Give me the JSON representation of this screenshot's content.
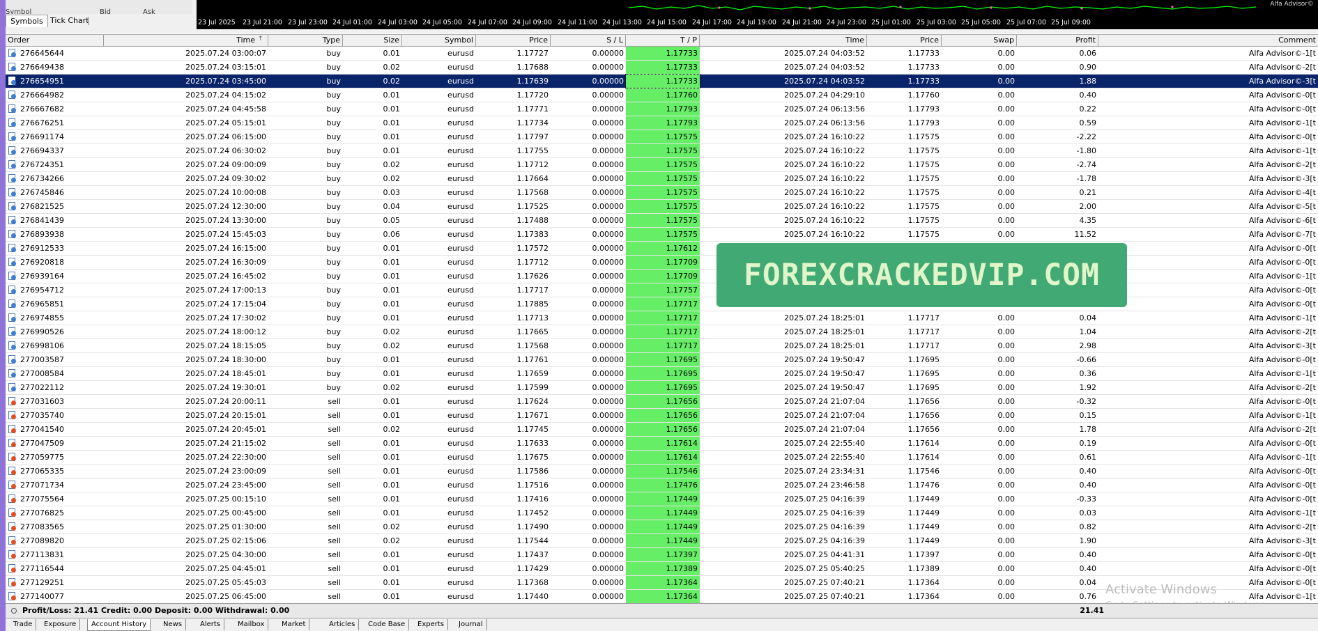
{
  "market_watch": {
    "col_symbol": "Symbol",
    "col_bid": "Bid",
    "col_ask": "Ask",
    "tabs": [
      "Symbols",
      "Tick Chart"
    ]
  },
  "chart": {
    "time_labels": [
      "23 Jul 2025",
      "23 Jul 21:00",
      "23 Jul 23:00",
      "24 Jul 01:00",
      "24 Jul 03:00",
      "24 Jul 05:00",
      "24 Jul 07:00",
      "24 Jul 09:00",
      "24 Jul 11:00",
      "24 Jul 13:00",
      "24 Jul 15:00",
      "24 Jul 17:00",
      "24 Jul 19:00",
      "24 Jul 21:00",
      "24 Jul 23:00",
      "25 Jul 01:00",
      "25 Jul 03:00",
      "25 Jul 05:00",
      "25 Jul 07:00",
      "25 Jul 09:00"
    ],
    "corner_label": "Alfa Advisor©",
    "accent": "#00ff00"
  },
  "table": {
    "headers": [
      "Order",
      "Time",
      "Type",
      "Size",
      "Symbol",
      "Price",
      "S / L",
      "T / P",
      "Time",
      "Price",
      "Swap",
      "Profit",
      "Comment"
    ],
    "selected_index": 2,
    "rows": [
      [
        "276645644",
        "2025.07.24 03:00:07",
        "buy",
        "0.01",
        "eurusd",
        "1.17727",
        "0.00000",
        "1.17733",
        "2025.07.24 04:03:52",
        "1.17733",
        "0.00",
        "0.06",
        "Alfa Advisor©-1[t"
      ],
      [
        "276649438",
        "2025.07.24 03:15:01",
        "buy",
        "0.02",
        "eurusd",
        "1.17688",
        "0.00000",
        "1.17733",
        "2025.07.24 04:03:52",
        "1.17733",
        "0.00",
        "0.90",
        "Alfa Advisor©-2[t"
      ],
      [
        "276654951",
        "2025.07.24 03:45:00",
        "buy",
        "0.02",
        "eurusd",
        "1.17639",
        "0.00000",
        "1.17733",
        "2025.07.24 04:03:52",
        "1.17733",
        "0.00",
        "1.88",
        "Alfa Advisor©-3[t"
      ],
      [
        "276664982",
        "2025.07.24 04:15:02",
        "buy",
        "0.01",
        "eurusd",
        "1.17720",
        "0.00000",
        "1.17760",
        "2025.07.24 04:29:10",
        "1.17760",
        "0.00",
        "0.40",
        "Alfa Advisor©-0[t"
      ],
      [
        "276667682",
        "2025.07.24 04:45:58",
        "buy",
        "0.01",
        "eurusd",
        "1.17771",
        "0.00000",
        "1.17793",
        "2025.07.24 06:13:56",
        "1.17793",
        "0.00",
        "0.22",
        "Alfa Advisor©-0[t"
      ],
      [
        "276676251",
        "2025.07.24 05:15:01",
        "buy",
        "0.01",
        "eurusd",
        "1.17734",
        "0.00000",
        "1.17793",
        "2025.07.24 06:13:56",
        "1.17793",
        "0.00",
        "0.59",
        "Alfa Advisor©-1[t"
      ],
      [
        "276691174",
        "2025.07.24 06:15:00",
        "buy",
        "0.01",
        "eurusd",
        "1.17797",
        "0.00000",
        "1.17575",
        "2025.07.24 16:10:22",
        "1.17575",
        "0.00",
        "-2.22",
        "Alfa Advisor©-0[t"
      ],
      [
        "276694337",
        "2025.07.24 06:30:02",
        "buy",
        "0.01",
        "eurusd",
        "1.17755",
        "0.00000",
        "1.17575",
        "2025.07.24 16:10:22",
        "1.17575",
        "0.00",
        "-1.80",
        "Alfa Advisor©-1[t"
      ],
      [
        "276724351",
        "2025.07.24 09:00:09",
        "buy",
        "0.02",
        "eurusd",
        "1.17712",
        "0.00000",
        "1.17575",
        "2025.07.24 16:10:22",
        "1.17575",
        "0.00",
        "-2.74",
        "Alfa Advisor©-2[t"
      ],
      [
        "276734266",
        "2025.07.24 09:30:02",
        "buy",
        "0.02",
        "eurusd",
        "1.17664",
        "0.00000",
        "1.17575",
        "2025.07.24 16:10:22",
        "1.17575",
        "0.00",
        "-1.78",
        "Alfa Advisor©-3[t"
      ],
      [
        "276745846",
        "2025.07.24 10:00:08",
        "buy",
        "0.03",
        "eurusd",
        "1.17568",
        "0.00000",
        "1.17575",
        "2025.07.24 16:10:22",
        "1.17575",
        "0.00",
        "0.21",
        "Alfa Advisor©-4[t"
      ],
      [
        "276821525",
        "2025.07.24 12:30:00",
        "buy",
        "0.04",
        "eurusd",
        "1.17525",
        "0.00000",
        "1.17575",
        "2025.07.24 16:10:22",
        "1.17575",
        "0.00",
        "2.00",
        "Alfa Advisor©-5[t"
      ],
      [
        "276841439",
        "2025.07.24 13:30:00",
        "buy",
        "0.05",
        "eurusd",
        "1.17488",
        "0.00000",
        "1.17575",
        "2025.07.24 16:10:22",
        "1.17575",
        "0.00",
        "4.35",
        "Alfa Advisor©-6[t"
      ],
      [
        "276893938",
        "2025.07.24 15:45:03",
        "buy",
        "0.06",
        "eurusd",
        "1.17383",
        "0.00000",
        "1.17575",
        "2025.07.24 16:10:22",
        "1.17575",
        "0.00",
        "11.52",
        "Alfa Advisor©-7[t"
      ],
      [
        "276912533",
        "2025.07.24 16:15:00",
        "buy",
        "0.01",
        "eurusd",
        "1.17572",
        "0.00000",
        "1.17612",
        "",
        "",
        "",
        "",
        "Alfa Advisor©-0[t"
      ],
      [
        "276920818",
        "2025.07.24 16:30:09",
        "buy",
        "0.01",
        "eurusd",
        "1.17712",
        "0.00000",
        "1.17709",
        "",
        "",
        "",
        "",
        "Alfa Advisor©-0[t"
      ],
      [
        "276939164",
        "2025.07.24 16:45:02",
        "buy",
        "0.01",
        "eurusd",
        "1.17626",
        "0.00000",
        "1.17709",
        "",
        "",
        "",
        "",
        "Alfa Advisor©-1[t"
      ],
      [
        "276954712",
        "2025.07.24 17:00:13",
        "buy",
        "0.01",
        "eurusd",
        "1.17717",
        "0.00000",
        "1.17757",
        "",
        "",
        "",
        "",
        "Alfa Advisor©-0[t"
      ],
      [
        "276965851",
        "2025.07.24 17:15:04",
        "buy",
        "0.01",
        "eurusd",
        "1.17885",
        "0.00000",
        "1.17717",
        "",
        "",
        "",
        "",
        "Alfa Advisor©-0[t"
      ],
      [
        "276974855",
        "2025.07.24 17:30:02",
        "buy",
        "0.01",
        "eurusd",
        "1.17713",
        "0.00000",
        "1.17717",
        "2025.07.24 18:25:01",
        "1.17717",
        "0.00",
        "0.04",
        "Alfa Advisor©-1[t"
      ],
      [
        "276990526",
        "2025.07.24 18:00:12",
        "buy",
        "0.02",
        "eurusd",
        "1.17665",
        "0.00000",
        "1.17717",
        "2025.07.24 18:25:01",
        "1.17717",
        "0.00",
        "1.04",
        "Alfa Advisor©-2[t"
      ],
      [
        "276998106",
        "2025.07.24 18:15:05",
        "buy",
        "0.02",
        "eurusd",
        "1.17568",
        "0.00000",
        "1.17717",
        "2025.07.24 18:25:01",
        "1.17717",
        "0.00",
        "2.98",
        "Alfa Advisor©-3[t"
      ],
      [
        "277003587",
        "2025.07.24 18:30:00",
        "buy",
        "0.01",
        "eurusd",
        "1.17761",
        "0.00000",
        "1.17695",
        "2025.07.24 19:50:47",
        "1.17695",
        "0.00",
        "-0.66",
        "Alfa Advisor©-0[t"
      ],
      [
        "277008584",
        "2025.07.24 18:45:01",
        "buy",
        "0.01",
        "eurusd",
        "1.17659",
        "0.00000",
        "1.17695",
        "2025.07.24 19:50:47",
        "1.17695",
        "0.00",
        "0.36",
        "Alfa Advisor©-1[t"
      ],
      [
        "277022112",
        "2025.07.24 19:30:01",
        "buy",
        "0.02",
        "eurusd",
        "1.17599",
        "0.00000",
        "1.17695",
        "2025.07.24 19:50:47",
        "1.17695",
        "0.00",
        "1.92",
        "Alfa Advisor©-2[t"
      ],
      [
        "277031603",
        "2025.07.24 20:00:11",
        "sell",
        "0.01",
        "eurusd",
        "1.17624",
        "0.00000",
        "1.17656",
        "2025.07.24 21:07:04",
        "1.17656",
        "0.00",
        "-0.32",
        "Alfa Advisor©-0[t"
      ],
      [
        "277035740",
        "2025.07.24 20:15:01",
        "sell",
        "0.01",
        "eurusd",
        "1.17671",
        "0.00000",
        "1.17656",
        "2025.07.24 21:07:04",
        "1.17656",
        "0.00",
        "0.15",
        "Alfa Advisor©-1[t"
      ],
      [
        "277041540",
        "2025.07.24 20:45:01",
        "sell",
        "0.02",
        "eurusd",
        "1.17745",
        "0.00000",
        "1.17656",
        "2025.07.24 21:07:04",
        "1.17656",
        "0.00",
        "1.78",
        "Alfa Advisor©-2[t"
      ],
      [
        "277047509",
        "2025.07.24 21:15:02",
        "sell",
        "0.01",
        "eurusd",
        "1.17633",
        "0.00000",
        "1.17614",
        "2025.07.24 22:55:40",
        "1.17614",
        "0.00",
        "0.19",
        "Alfa Advisor©-0[t"
      ],
      [
        "277059775",
        "2025.07.24 22:30:00",
        "sell",
        "0.01",
        "eurusd",
        "1.17675",
        "0.00000",
        "1.17614",
        "2025.07.24 22:55:40",
        "1.17614",
        "0.00",
        "0.61",
        "Alfa Advisor©-1[t"
      ],
      [
        "277065335",
        "2025.07.24 23:00:09",
        "sell",
        "0.01",
        "eurusd",
        "1.17586",
        "0.00000",
        "1.17546",
        "2025.07.24 23:34:31",
        "1.17546",
        "0.00",
        "0.40",
        "Alfa Advisor©-0[t"
      ],
      [
        "277071734",
        "2025.07.24 23:45:00",
        "sell",
        "0.01",
        "eurusd",
        "1.17516",
        "0.00000",
        "1.17476",
        "2025.07.24 23:46:58",
        "1.17476",
        "0.00",
        "0.40",
        "Alfa Advisor©-0[t"
      ],
      [
        "277075564",
        "2025.07.25 00:15:10",
        "sell",
        "0.01",
        "eurusd",
        "1.17416",
        "0.00000",
        "1.17449",
        "2025.07.25 04:16:39",
        "1.17449",
        "0.00",
        "-0.33",
        "Alfa Advisor©-0[t"
      ],
      [
        "277076825",
        "2025.07.25 00:45:00",
        "sell",
        "0.01",
        "eurusd",
        "1.17452",
        "0.00000",
        "1.17449",
        "2025.07.25 04:16:39",
        "1.17449",
        "0.00",
        "0.03",
        "Alfa Advisor©-1[t"
      ],
      [
        "277083565",
        "2025.07.25 01:30:00",
        "sell",
        "0.02",
        "eurusd",
        "1.17490",
        "0.00000",
        "1.17449",
        "2025.07.25 04:16:39",
        "1.17449",
        "0.00",
        "0.82",
        "Alfa Advisor©-2[t"
      ],
      [
        "277089820",
        "2025.07.25 02:15:06",
        "sell",
        "0.02",
        "eurusd",
        "1.17544",
        "0.00000",
        "1.17449",
        "2025.07.25 04:16:39",
        "1.17449",
        "0.00",
        "1.90",
        "Alfa Advisor©-3[t"
      ],
      [
        "277113831",
        "2025.07.25 04:30:00",
        "sell",
        "0.01",
        "eurusd",
        "1.17437",
        "0.00000",
        "1.17397",
        "2025.07.25 04:41:31",
        "1.17397",
        "0.00",
        "0.40",
        "Alfa Advisor©-0[t"
      ],
      [
        "277116544",
        "2025.07.25 04:45:01",
        "sell",
        "0.01",
        "eurusd",
        "1.17429",
        "0.00000",
        "1.17389",
        "2025.07.25 05:40:25",
        "1.17389",
        "0.00",
        "0.40",
        "Alfa Advisor©-0[t"
      ],
      [
        "277129251",
        "2025.07.25 05:45:03",
        "sell",
        "0.01",
        "eurusd",
        "1.17368",
        "0.00000",
        "1.17364",
        "2025.07.25 07:40:21",
        "1.17364",
        "0.00",
        "0.04",
        "Alfa Advisor©-0[t"
      ],
      [
        "277140077",
        "2025.07.25 06:45:00",
        "sell",
        "0.01",
        "eurusd",
        "1.17440",
        "0.00000",
        "1.17364",
        "2025.07.25 07:40:21",
        "1.17364",
        "0.00",
        "0.76",
        "Alfa Advisor©-1[t"
      ]
    ]
  },
  "footer": {
    "summary": "Profit/Loss: 21.41   Credit: 0.00   Deposit: 0.00   Withdrawal: 0.00",
    "total": "21.41"
  },
  "bottom_tabs": [
    "Trade",
    "Exposure",
    "Account History",
    "News",
    "Alerts",
    "Mailbox",
    "Market",
    "Articles",
    "Code Base",
    "Experts",
    "Journal"
  ],
  "watermark": "FOREXCRACKEDVIP.COM",
  "activate": {
    "title": "Activate Windows",
    "subtitle": "Go to Settings to activate Windows."
  }
}
